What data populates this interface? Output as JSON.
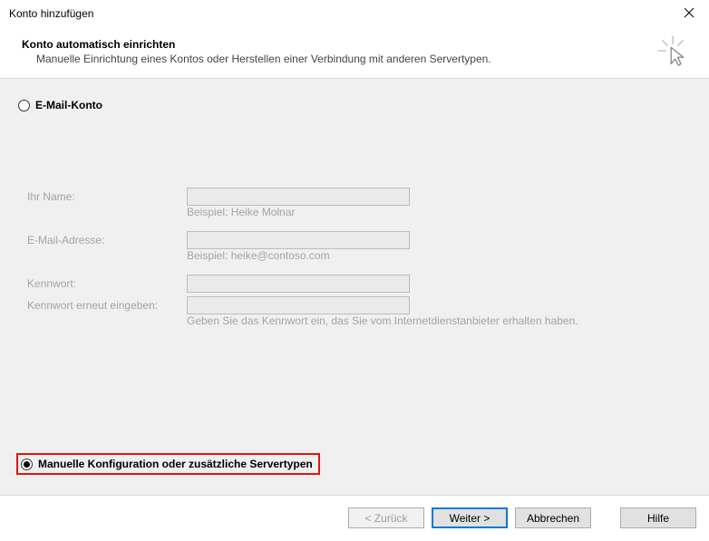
{
  "window": {
    "title": "Konto hinzufügen"
  },
  "header": {
    "heading": "Konto automatisch einrichten",
    "subheading": "Manuelle Einrichtung eines Kontos oder Herstellen einer Verbindung mit anderen Servertypen."
  },
  "radio_email": {
    "label": "E-Mail-Konto"
  },
  "form": {
    "name_label": "Ihr Name:",
    "name_hint": "Beispiel: Heike Molnar",
    "email_label": "E-Mail-Adresse:",
    "email_hint": "Beispiel: heike@contoso.com",
    "password_label": "Kennwort:",
    "password2_label": "Kennwort erneut eingeben:",
    "password_hint": "Geben Sie das Kennwort ein, das Sie vom Internetdienstanbieter erhalten haben."
  },
  "radio_manual": {
    "label": "Manuelle Konfiguration oder zusätzliche Servertypen"
  },
  "buttons": {
    "back": "< Zurück",
    "next": "Weiter >",
    "cancel": "Abbrechen",
    "help": "Hilfe"
  }
}
